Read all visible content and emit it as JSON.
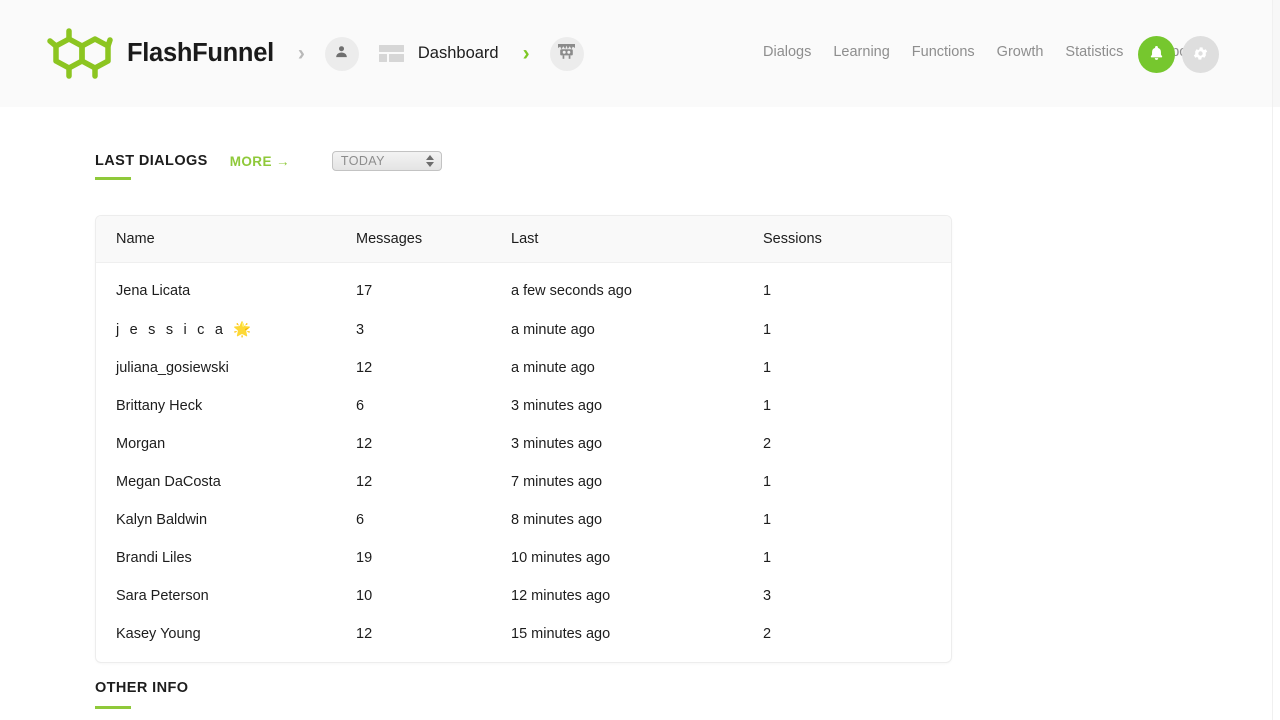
{
  "header": {
    "brand_name": "FlashFunnel",
    "logo_icon": "molecule-logo-icon",
    "separator": "›",
    "breadcrumb": {
      "avatar_icon": "person-icon",
      "dashboard_icon": "dashboard-grid-icon",
      "dashboard_label": "Dashboard",
      "bot_icon": "bot-icon"
    },
    "nav": [
      {
        "label": "Dialogs"
      },
      {
        "label": "Learning"
      },
      {
        "label": "Functions"
      },
      {
        "label": "Growth"
      },
      {
        "label": "Statistics"
      },
      {
        "label": "Support"
      }
    ],
    "actions": {
      "bell_icon": "bell-icon",
      "gear_icon": "gear-icon",
      "bell_color": "#76c72e",
      "gear_color": "#dedede"
    }
  },
  "main": {
    "section": {
      "title": "LAST DIALOGS",
      "more_label": "MORE →",
      "period_value": "TODAY",
      "accent_color": "#8fc93a"
    },
    "table": {
      "columns": [
        "Name",
        "Messages",
        "Last",
        "Sessions"
      ],
      "rows": [
        {
          "name": "Jena Licata",
          "messages": "17",
          "last": "a few seconds ago",
          "sessions": "1"
        },
        {
          "name": "j e s s i c a 🌟",
          "messages": "3",
          "last": "a minute ago",
          "sessions": "1"
        },
        {
          "name": "juliana_gosiewski",
          "messages": "12",
          "last": "a minute ago",
          "sessions": "1"
        },
        {
          "name": "Brittany Heck",
          "messages": "6",
          "last": "3 minutes ago",
          "sessions": "1"
        },
        {
          "name": "Morgan",
          "messages": "12",
          "last": "3 minutes ago",
          "sessions": "2"
        },
        {
          "name": "Megan DaCosta",
          "messages": "12",
          "last": "7 minutes ago",
          "sessions": "1"
        },
        {
          "name": "Kalyn Baldwin",
          "messages": "6",
          "last": "8 minutes ago",
          "sessions": "1"
        },
        {
          "name": "Brandi Liles",
          "messages": "19",
          "last": "10 minutes ago",
          "sessions": "1"
        },
        {
          "name": "Sara Peterson",
          "messages": "10",
          "last": "12 minutes ago",
          "sessions": "3"
        },
        {
          "name": "Kasey Young",
          "messages": "12",
          "last": "15 minutes ago",
          "sessions": "2"
        }
      ]
    },
    "other_info": {
      "title": "OTHER INFO"
    }
  }
}
